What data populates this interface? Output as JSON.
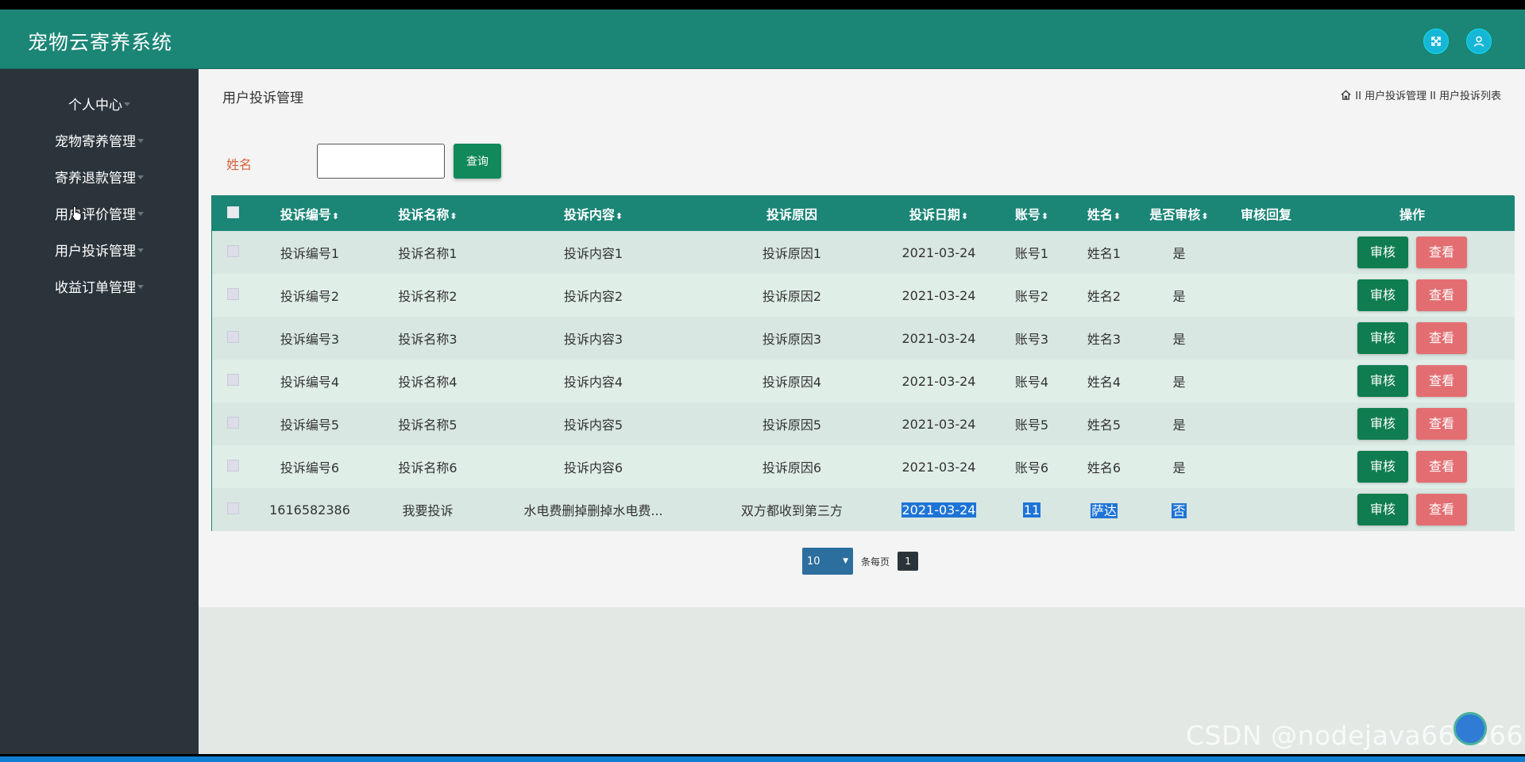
{
  "app": {
    "title": "宠物云寄养系统"
  },
  "sidebar": {
    "items": [
      {
        "label": "个人中心"
      },
      {
        "label": "宠物寄养管理"
      },
      {
        "label": "寄养退款管理"
      },
      {
        "label": "用户评价管理"
      },
      {
        "label": "用户投诉管理"
      },
      {
        "label": "收益订单管理"
      }
    ]
  },
  "main": {
    "page_title": "用户投诉管理",
    "breadcrumb": "II 用户投诉管理 II 用户投诉列表"
  },
  "search": {
    "label": "姓名",
    "value": "",
    "button": "查询"
  },
  "table": {
    "headers": [
      "投诉编号",
      "投诉名称",
      "投诉内容",
      "投诉原因",
      "投诉日期",
      "账号",
      "姓名",
      "是否审核",
      "审核回复",
      "操作"
    ],
    "sort_glyph": "⬍",
    "actions": {
      "audit": "审核",
      "view": "查看"
    },
    "rows": [
      [
        "投诉编号1",
        "投诉名称1",
        "投诉内容1",
        "投诉原因1",
        "2021-03-24",
        "账号1",
        "姓名1",
        "是",
        ""
      ],
      [
        "投诉编号2",
        "投诉名称2",
        "投诉内容2",
        "投诉原因2",
        "2021-03-24",
        "账号2",
        "姓名2",
        "是",
        ""
      ],
      [
        "投诉编号3",
        "投诉名称3",
        "投诉内容3",
        "投诉原因3",
        "2021-03-24",
        "账号3",
        "姓名3",
        "是",
        ""
      ],
      [
        "投诉编号4",
        "投诉名称4",
        "投诉内容4",
        "投诉原因4",
        "2021-03-24",
        "账号4",
        "姓名4",
        "是",
        ""
      ],
      [
        "投诉编号5",
        "投诉名称5",
        "投诉内容5",
        "投诉原因5",
        "2021-03-24",
        "账号5",
        "姓名5",
        "是",
        ""
      ],
      [
        "投诉编号6",
        "投诉名称6",
        "投诉内容6",
        "投诉原因6",
        "2021-03-24",
        "账号6",
        "姓名6",
        "是",
        ""
      ],
      [
        "1616582386",
        "我要投诉",
        "水电费删掉删掉水电费...",
        "双方都收到第三方",
        "2021-03-24",
        "11",
        "萨达",
        "否",
        ""
      ]
    ]
  },
  "pager": {
    "page_size": "10",
    "per_page_label": "条每页",
    "current_page": "1"
  },
  "watermark": "CSDN @nodejava666666",
  "colors": {
    "header": "#1b8576",
    "sidebar": "#2b343b",
    "audit_button": "#0f7d4f",
    "view_button": "#e36e72",
    "label_accent": "#d9633e"
  }
}
